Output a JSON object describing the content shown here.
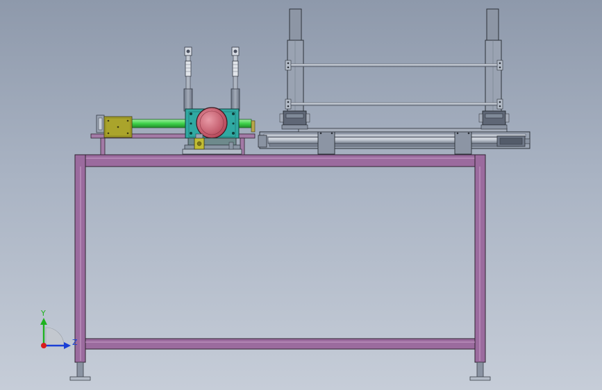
{
  "triad": {
    "y_label": "Y",
    "z_label": "Z",
    "y_color": "#1fb21f",
    "z_color": "#1a3fd6",
    "x_color": "#d81c1c"
  },
  "colors": {
    "frame": "#9a6a9c",
    "frame_edge": "#3a2a3c",
    "tube": "#3fd24a",
    "motor_box": "#a8a22a",
    "housing": "#2fa7a0",
    "rotor": "#c85a6a",
    "steel": "#8c96a6",
    "steel_dark": "#5c6472",
    "background_top": "#8e99ab",
    "background_bottom": "#c6cdd8"
  }
}
